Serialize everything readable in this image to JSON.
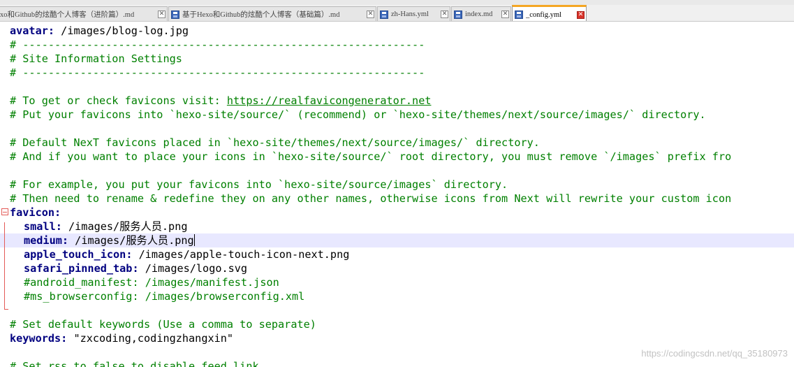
{
  "tabs": [
    {
      "label": "xo和Github的炫酷个人博客（进阶篇）.md",
      "active": false
    },
    {
      "label": "基于Hexo和Github的炫酷个人博客（基础篇）.md",
      "active": false
    },
    {
      "label": "zh-Hans.yml",
      "active": false
    },
    {
      "label": "index.md",
      "active": false
    },
    {
      "label": "_config.yml",
      "active": true
    }
  ],
  "close_glyph": "✕",
  "lines": {
    "l1": {
      "key": "avatar",
      "value": " /images/blog-log.jpg"
    },
    "l2": "# ---------------------------------------------------------------",
    "l3": "# Site Information Settings",
    "l4": "# ---------------------------------------------------------------",
    "l6_text": "# To get or check favicons visit: ",
    "l6_link": "https://realfavicongenerator.net",
    "l7": "# Put your favicons into `hexo-site/source/` (recommend) or `hexo-site/themes/next/source/images/` directory.",
    "l9": "# Default NexT favicons placed in `hexo-site/themes/next/source/images/` directory.",
    "l10": "# And if you want to place your icons in `hexo-site/source/` root directory, you must remove `/images` prefix fro",
    "l12": "# For example, you put your favicons into `hexo-site/source/images` directory.",
    "l13": "# Then need to rename & redefine they on any other names, otherwise icons from Next will rewrite your custom icon",
    "l14": {
      "key": "favicon"
    },
    "l15": {
      "key": "small",
      "value": " /images/服务人员.png"
    },
    "l16": {
      "key": "medium",
      "value": " /images/服务人员.png"
    },
    "l17": {
      "key": "apple_touch_icon",
      "value": " /images/apple-touch-icon-next.png"
    },
    "l18": {
      "key": "safari_pinned_tab",
      "value": " /images/logo.svg"
    },
    "l19": "#android_manifest: /images/manifest.json",
    "l20": "#ms_browserconfig: /images/browserconfig.xml",
    "l22": "# Set default keywords (Use a comma to separate)",
    "l23": {
      "key": "keywords",
      "value": " \"zxcoding,codingzhangxin\""
    },
    "l25": "# Set rss to false to disable feed link"
  },
  "colon": ":",
  "watermark": "https://codingcsdn.net/qq_35180973"
}
